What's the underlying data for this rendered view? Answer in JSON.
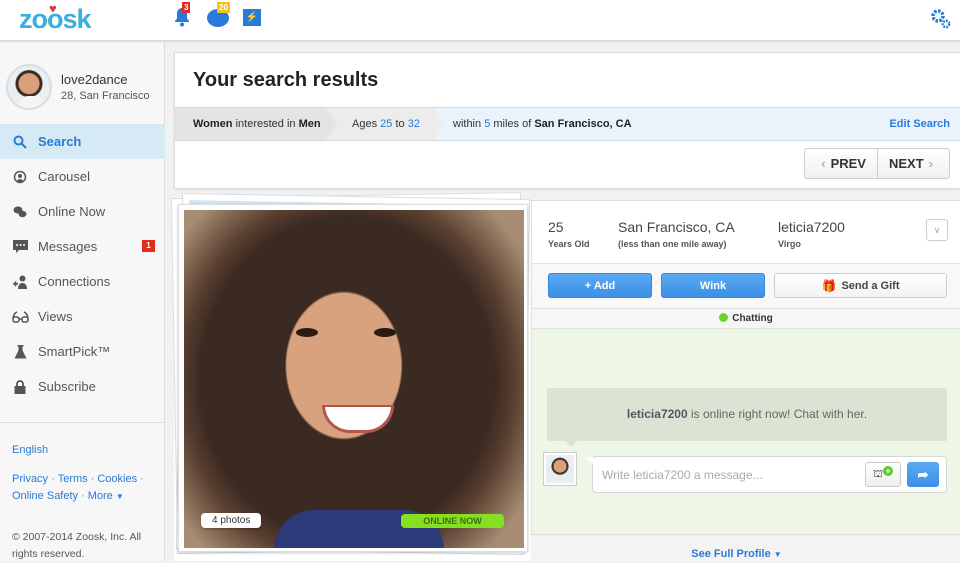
{
  "topbar": {
    "logo": "zoosk",
    "notifications_count": "3",
    "coins_count": "20",
    "icons": [
      "bell-icon",
      "coins-icon",
      "boost-icon",
      "settings-gear-icon"
    ]
  },
  "user": {
    "name": "love2dance",
    "details": "28, San Francisco"
  },
  "sidebar": {
    "items": [
      {
        "label": "Search",
        "icon": "search-icon",
        "active": true
      },
      {
        "label": "Carousel",
        "icon": "carousel-icon"
      },
      {
        "label": "Online Now",
        "icon": "chat-bubbles-icon"
      },
      {
        "label": "Messages",
        "icon": "message-icon",
        "badge": "1"
      },
      {
        "label": "Connections",
        "icon": "connections-icon"
      },
      {
        "label": "Views",
        "icon": "glasses-icon"
      },
      {
        "label": "SmartPick™",
        "icon": "flask-icon"
      },
      {
        "label": "Subscribe",
        "icon": "lock-icon"
      }
    ],
    "footer": {
      "language": "English",
      "links": [
        "Privacy",
        "Terms",
        "Cookies",
        "Online Safety",
        "More"
      ],
      "copyright": "© 2007-2014 Zoosk, Inc. All rights reserved."
    }
  },
  "header": {
    "title": "Your search results",
    "filters": {
      "gender_a": "Women",
      "interested_in": "interested in",
      "gender_b": "Men",
      "ages_label": "Ages",
      "age_min": "25",
      "age_to": "to",
      "age_max": "32",
      "within": "within",
      "miles": "5",
      "miles_of": "miles of",
      "location": "San Francisco, CA"
    },
    "edit_search": "Edit Search",
    "prev": "PREV",
    "next": "NEXT"
  },
  "result": {
    "photos_count": "4 photos",
    "online_badge": "ONLINE NOW",
    "age": "25",
    "age_label": "Years Old",
    "location": "San Francisco, CA",
    "distance": "(less than one mile away)",
    "username": "leticia7200",
    "sign": "Virgo",
    "add_label": "+ Add",
    "wink_label": "Wink",
    "gift_label": "Send a Gift",
    "status": "Chatting",
    "online_msg_name": "leticia7200",
    "online_msg_text": " is online right now! Chat with her.",
    "message_placeholder": "Write leticia7200 a message...",
    "see_full_profile": "See Full Profile"
  },
  "colors": {
    "brand": "#3aaee0",
    "accent": "#2a7ad9",
    "badge_red": "#e42b1f",
    "online_green": "#86e021",
    "chat_bg": "#eef7e6"
  }
}
